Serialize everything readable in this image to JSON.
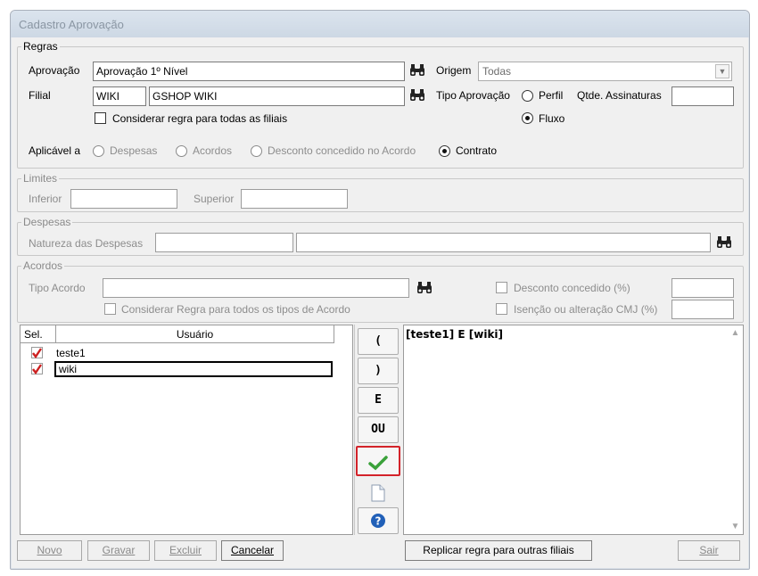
{
  "window": {
    "title": "Cadastro Aprovação"
  },
  "regras": {
    "legend": "Regras",
    "aprovacao_label": "Aprovação",
    "aprovacao_value": "Aprovação 1º Nível",
    "origem_label": "Origem",
    "origem_value": "Todas",
    "filial_label": "Filial",
    "filial_code": "WIKI",
    "filial_name": "GSHOP WIKI",
    "tipo_aprovacao_label": "Tipo Aprovação",
    "perfil_label": "Perfil",
    "fluxo_label": "Fluxo",
    "tipo_selected": "Fluxo",
    "qtde_assinaturas_label": "Qtde. Assinaturas",
    "qtde_assinaturas_value": "",
    "considerar_filiais_label": "Considerar regra para todas as filiais",
    "considerar_filiais_checked": false,
    "aplicavel_label": "Aplicável a",
    "aplicavel_options": [
      "Despesas",
      "Acordos",
      "Desconto concedido no Acordo",
      "Contrato"
    ],
    "aplicavel_selected": "Contrato"
  },
  "limites": {
    "legend": "Limites",
    "inferior_label": "Inferior",
    "inferior_value": "",
    "superior_label": "Superior",
    "superior_value": ""
  },
  "despesas": {
    "legend": "Despesas",
    "natureza_label": "Natureza das Despesas",
    "natureza_code": "",
    "natureza_desc": ""
  },
  "acordos": {
    "legend": "Acordos",
    "tipo_acordo_label": "Tipo Acordo",
    "tipo_acordo_value": "",
    "considerar_tipos_label": "Considerar Regra para todos os tipos de Acordo",
    "desconto_label": "Desconto concedido (%)",
    "desconto_value": "",
    "isencao_label": "Isenção ou alteração CMJ (%)",
    "isencao_value": ""
  },
  "usuarios_grid": {
    "columns": [
      "Sel.",
      "Usuário"
    ],
    "rows": [
      {
        "selected": true,
        "name": "teste1"
      },
      {
        "selected": true,
        "name": "wiki"
      }
    ]
  },
  "operators": {
    "open_paren": "(",
    "close_paren": ")",
    "and": "E",
    "or": "OU"
  },
  "expression": "[teste1] E [wiki]",
  "footer": {
    "novo": "Novo",
    "gravar": "Gravar",
    "excluir": "Excluir",
    "cancelar": "Cancelar",
    "replicar": "Replicar regra para outras filiais",
    "sair": "Sair"
  },
  "colors": {
    "check_mark": "#cc1f1f",
    "confirm_green": "#3aa13a",
    "help_blue": "#2160b8",
    "highlight_red": "#d3232a"
  }
}
